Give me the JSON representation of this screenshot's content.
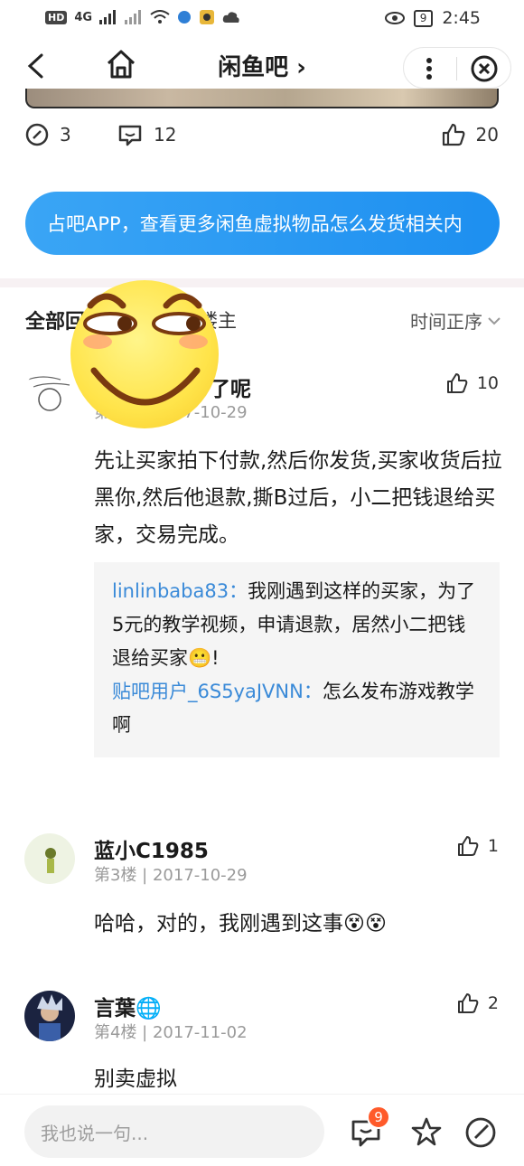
{
  "status_bar": {
    "time": "2:45",
    "battery": "9",
    "chips": [
      "HD",
      "4G"
    ]
  },
  "nav": {
    "title": "闲鱼吧 ›"
  },
  "stats": {
    "shares": "3",
    "comments": "12",
    "likes": "20"
  },
  "open_app_banner": {
    "text": "占吧APP，查看更多闲鱼虚拟物品怎么发货相关内"
  },
  "filter": {
    "all": "全部回",
    "lz": "楼主",
    "sort": "时间正序"
  },
  "posts": [
    {
      "name": "了呢",
      "meta": "第2楼 | 2017-10-29",
      "likes": "10",
      "content": "先让买家拍下付款,然后你发货,买家收货后拉黑你,然后他退款,撕B过后，小二把钱退给买家，交易完成。",
      "replies": [
        {
          "user": "linlinbaba83：",
          "text": "我刚遇到这样的买家，为了5元的教学视频，申请退款，居然小二把钱退给买家😬!"
        },
        {
          "user": "贴吧用户_6S5yaJVNN：",
          "text": "怎么发布游戏教学啊"
        }
      ]
    },
    {
      "name": "蓝小C1985",
      "meta": "第3楼 | 2017-10-29",
      "likes": "1",
      "content": "哈哈，对的，我刚遇到这事😵😵"
    },
    {
      "name": "言葉🌐",
      "meta": "第4楼 | 2017-11-02",
      "likes": "2",
      "content": "别卖虚拟"
    }
  ],
  "bottom": {
    "placeholder": "我也说一句...",
    "badge": "9"
  }
}
